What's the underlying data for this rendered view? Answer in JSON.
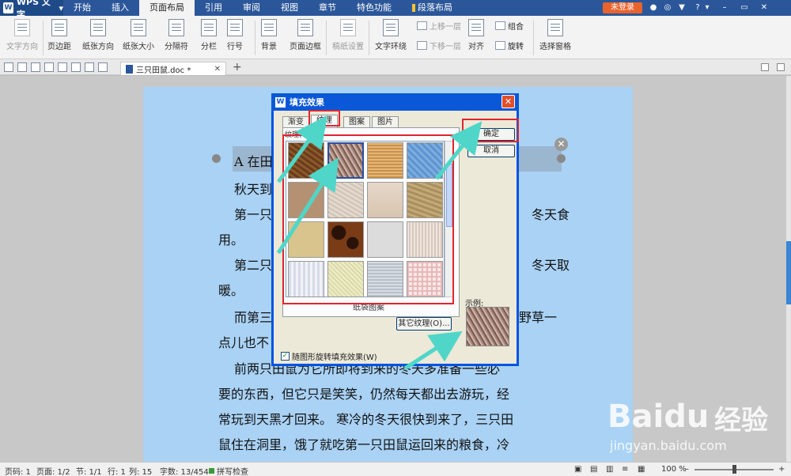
{
  "app": {
    "name": "WPS 文字",
    "login_label": "未登录"
  },
  "menu_tabs": [
    "开始",
    "插入",
    "页面布局",
    "引用",
    "审阅",
    "视图",
    "章节",
    "特色功能",
    "段落布局"
  ],
  "ribbon": {
    "text_direction": "文字方向",
    "margins": "页边距",
    "orientation": "纸张方向",
    "size": "纸张大小",
    "breaks": "分隔符",
    "columns": "分栏",
    "line_numbers": "行号",
    "background": "背景",
    "page_border": "页面边框",
    "manuscript": "稿纸设置",
    "text_wrap": "文字环绕",
    "bring_forward": "上移一层",
    "send_backward": "下移一层",
    "align": "对齐",
    "group": "组合",
    "rotate": "旋转",
    "selection_pane": "选择窗格"
  },
  "doc_tab": {
    "name": "三只田鼠.doc *"
  },
  "document_lines": [
    "A 在田",
    "秋天到",
    "第一只",
    "冬天食",
    "用。",
    "第二只",
    "冬天取",
    "暖。",
    "而第三",
    "野草一",
    "点儿也不",
    "前两只田鼠为它所即将到来的冬天多准备一些必",
    "要的东西，但它只是笑笑，仍然每天都出去游玩，经",
    "常玩到天黑才回来。 寒冷的冬天很快到来了，三只田",
    "鼠住在洞里，饿了就吃第一只田鼠运回来的粮食，冷"
  ],
  "dialog": {
    "title": "填充效果",
    "tabs": [
      "渐变",
      "纹理",
      "图案",
      "图片"
    ],
    "texture_label": "纹理(T):",
    "texture_name": "纸袋图案",
    "other_button": "其它纹理(O)...",
    "ok_button": "确定",
    "cancel_button": "取消",
    "preview_label": "示例:",
    "rotate_checkbox": "随图形旋转填充效果(W)"
  },
  "statusbar": {
    "page_no": "页码: 1",
    "page": "页面: 1/2",
    "section": "节: 1/1",
    "row": "行: 1",
    "col": "列: 15",
    "words": "字数: 13/454",
    "spell": "拼写检查",
    "zoom": "100 %"
  },
  "watermark": {
    "main": "Baidu",
    "cn": "经验",
    "sub": "jingyan.baidu.com"
  }
}
